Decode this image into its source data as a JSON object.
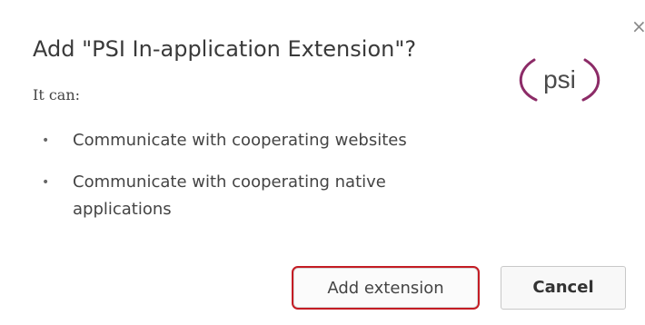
{
  "dialog": {
    "title": "Add \"PSI In-application Extension\"?",
    "intro": "It can:",
    "permissions": [
      "Communicate with cooperating websites",
      "Communicate with cooperating native applications"
    ],
    "bullet": "•",
    "close_glyph": "×",
    "logo_text": "psi",
    "logo_icon": "psi-logo-icon",
    "primary_button": "Add extension",
    "secondary_button": "Cancel"
  },
  "colors": {
    "highlight_border": "#c41c24",
    "logo_ring": "#8c2b67",
    "text": "#444444"
  }
}
